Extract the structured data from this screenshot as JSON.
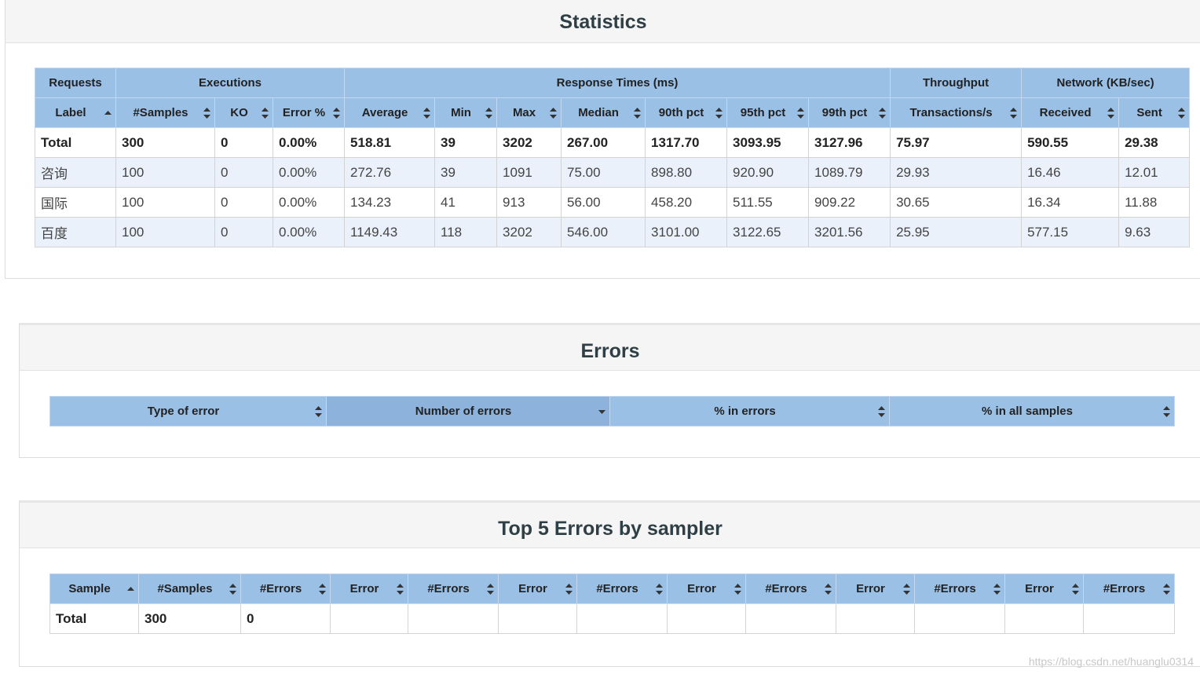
{
  "statistics": {
    "title": "Statistics",
    "group_headers": [
      "Requests",
      "Executions",
      "Response Times (ms)",
      "Throughput",
      "Network (KB/sec)"
    ],
    "columns": [
      "Label",
      "#Samples",
      "KO",
      "Error %",
      "Average",
      "Min",
      "Max",
      "Median",
      "90th pct",
      "95th pct",
      "99th pct",
      "Transactions/s",
      "Received",
      "Sent"
    ],
    "rows": [
      [
        "Total",
        "300",
        "0",
        "0.00%",
        "518.81",
        "39",
        "3202",
        "267.00",
        "1317.70",
        "3093.95",
        "3127.96",
        "75.97",
        "590.55",
        "29.38"
      ],
      [
        "咨询",
        "100",
        "0",
        "0.00%",
        "272.76",
        "39",
        "1091",
        "75.00",
        "898.80",
        "920.90",
        "1089.79",
        "29.93",
        "16.46",
        "12.01"
      ],
      [
        "国际",
        "100",
        "0",
        "0.00%",
        "134.23",
        "41",
        "913",
        "56.00",
        "458.20",
        "511.55",
        "909.22",
        "30.65",
        "16.34",
        "11.88"
      ],
      [
        "百度",
        "100",
        "0",
        "0.00%",
        "1149.43",
        "118",
        "3202",
        "546.00",
        "3101.00",
        "3122.65",
        "3201.56",
        "25.95",
        "577.15",
        "9.63"
      ]
    ]
  },
  "errors": {
    "title": "Errors",
    "columns": [
      "Type of error",
      "Number of errors",
      "% in errors",
      "% in all samples"
    ]
  },
  "top_errors": {
    "title": "Top 5 Errors by sampler",
    "columns": [
      "Sample",
      "#Samples",
      "#Errors",
      "Error",
      "#Errors",
      "Error",
      "#Errors",
      "Error",
      "#Errors",
      "Error",
      "#Errors",
      "Error",
      "#Errors"
    ],
    "rows": [
      [
        "Total",
        "300",
        "0",
        "",
        "",
        "",
        "",
        "",
        "",
        "",
        "",
        "",
        ""
      ]
    ]
  },
  "watermark": "https://blog.csdn.net/huanglu0314"
}
